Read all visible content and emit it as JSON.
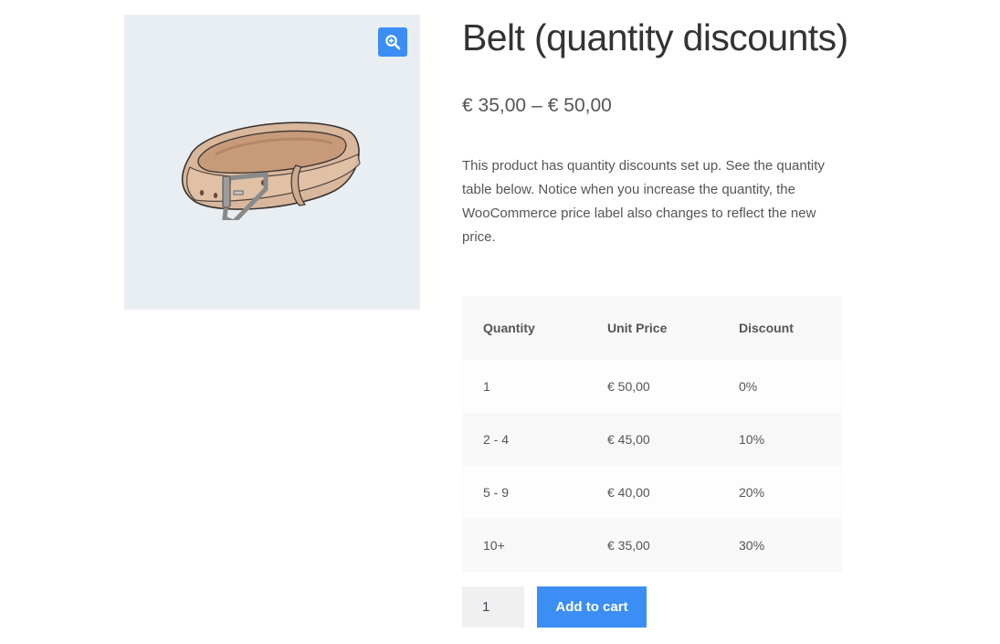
{
  "product": {
    "title": "Belt (quantity discounts)",
    "price_min": "€ 35,00",
    "price_separator": "–",
    "price_max": "€ 50,00",
    "description": "This product has quantity discounts set up. See the quantity table below. Notice when you increase the quantity, the WooCommerce price label also changes to reflect the new price."
  },
  "gallery": {
    "zoom_icon": "zoom-in-magnifier-icon",
    "accent_color": "#3c8ef5"
  },
  "table": {
    "headers": [
      "Quantity",
      "Unit Price",
      "Discount"
    ],
    "rows": [
      [
        "1",
        "€ 50,00",
        "0%"
      ],
      [
        "2 - 4",
        "€ 45,00",
        "10%"
      ],
      [
        "5 - 9",
        "€ 40,00",
        "20%"
      ],
      [
        "10+",
        "€ 35,00",
        "30%"
      ]
    ]
  },
  "cart": {
    "quantity_value": "1",
    "add_to_cart_label": "Add to cart"
  }
}
